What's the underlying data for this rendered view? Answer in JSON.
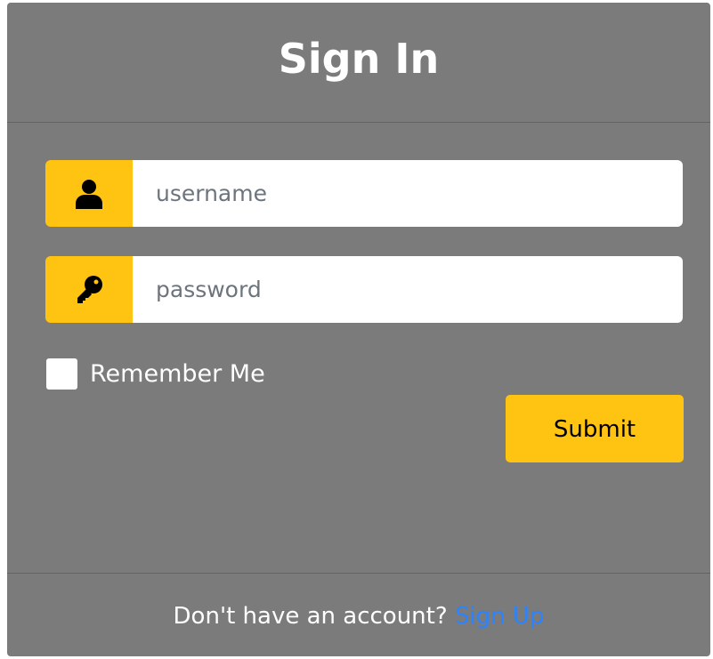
{
  "header": {
    "title": "Sign In"
  },
  "form": {
    "username": {
      "icon": "user-icon",
      "value": "",
      "placeholder": "username"
    },
    "password": {
      "icon": "key-icon",
      "value": "",
      "placeholder": "password"
    },
    "remember": {
      "label": "Remember Me",
      "checked": false
    },
    "submit_label": "Submit"
  },
  "footer": {
    "prompt": "Don't have an account?",
    "link_label": "Sign Up"
  },
  "colors": {
    "accent": "#ffc312",
    "card_background": "#7b7b7b",
    "link": "#2a84ff"
  }
}
